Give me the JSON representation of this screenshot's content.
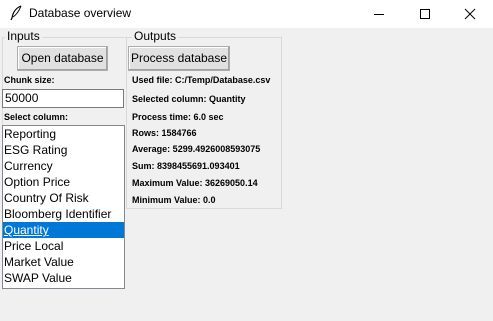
{
  "window": {
    "title": "Database overview",
    "icon": "feather-icon",
    "controls": [
      "minimize-icon",
      "maximize-icon",
      "close-icon"
    ]
  },
  "inputs": {
    "group_label": "Inputs",
    "open_button": "Open database",
    "chunk_label": "Chunk size:",
    "chunk_value": "50000",
    "select_label": "Select column:",
    "columns": [
      "Reporting",
      "ESG Rating",
      "Currency",
      "Option Price",
      "Country Of Risk",
      "Bloomberg Identifier",
      "Quantity",
      "Price Local",
      "Market Value",
      "SWAP Value"
    ],
    "selected_column": "Quantity"
  },
  "outputs": {
    "group_label": "Outputs",
    "process_button": "Process database",
    "lines": [
      "Used file: C:/Temp/Database.csv",
      "Selected column: Quantity",
      "Process time: 6.0 sec",
      "Rows: 1584766",
      "Average: 5299.4926008593075",
      "Sum: 8398455691.093401",
      "Maximum Value: 36269050.14",
      "Minimum Value: 0.0"
    ]
  },
  "colors": {
    "selection": "#0078d7",
    "window_bg": "#f0f0f0"
  }
}
